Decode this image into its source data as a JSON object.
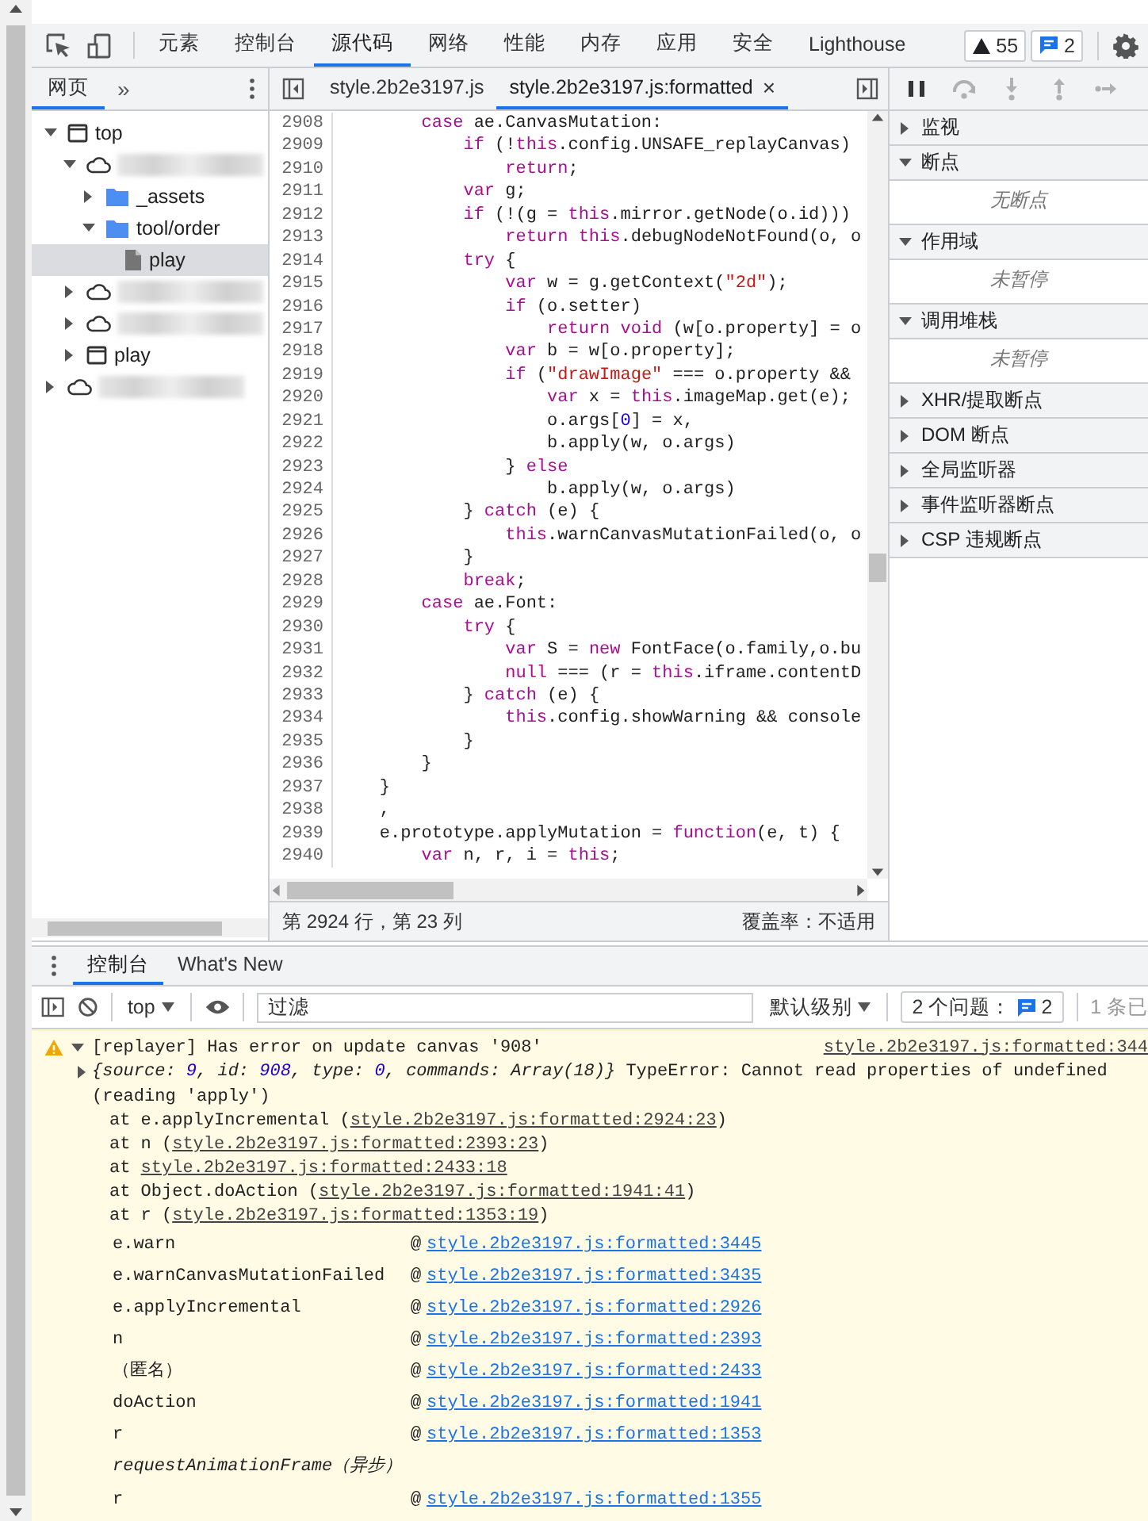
{
  "main_toolbar": {
    "tabs": [
      {
        "label": "元素",
        "selected": false
      },
      {
        "label": "控制台",
        "selected": false
      },
      {
        "label": "源代码",
        "selected": true
      },
      {
        "label": "网络",
        "selected": false
      },
      {
        "label": "性能",
        "selected": false
      },
      {
        "label": "内存",
        "selected": false
      },
      {
        "label": "应用",
        "selected": false
      },
      {
        "label": "安全",
        "selected": false
      },
      {
        "label": "Lighthouse",
        "selected": false
      }
    ],
    "badges": [
      {
        "kind": "warnings",
        "count": "55"
      },
      {
        "kind": "messages",
        "count": "2"
      }
    ]
  },
  "navigator": {
    "tabs": [
      {
        "label": "网页",
        "selected": true
      }
    ],
    "more": "»",
    "tree": [
      {
        "kind": "frame",
        "label": "top",
        "expanded": true,
        "selected": false,
        "children": [
          {
            "kind": "cloud",
            "redacted": true,
            "expanded": true,
            "selected": false,
            "children": [
              {
                "kind": "folder",
                "label": "_assets",
                "expanded": false,
                "selected": false
              },
              {
                "kind": "folder",
                "label": "tool/order",
                "expanded": true,
                "selected": false,
                "children": [
                  {
                    "kind": "file",
                    "label": "play",
                    "selected": true
                  }
                ]
              }
            ]
          },
          {
            "kind": "cloud",
            "redacted": true,
            "expanded": false,
            "selected": false
          },
          {
            "kind": "cloud",
            "redacted": true,
            "expanded": false,
            "selected": false
          },
          {
            "kind": "frame",
            "label": "play",
            "expanded": false,
            "selected": false
          }
        ]
      },
      {
        "kind": "cloud",
        "redacted": true,
        "expanded": false,
        "selected": false
      }
    ]
  },
  "editor": {
    "tabs": [
      {
        "label": "style.2b2e3197.js",
        "selected": false
      },
      {
        "label": "style.2b2e3197.js:formatted",
        "selected": true,
        "close": "×"
      }
    ],
    "lines": [
      {
        "number": "2908",
        "code": [
          {
            "kind": "keyword",
            "text": "        case"
          },
          {
            "kind": "plain",
            "text": " ae.CanvasMutation:"
          }
        ]
      },
      {
        "number": "2909",
        "code": [
          {
            "kind": "keyword",
            "text": "            if"
          },
          {
            "kind": "plain",
            "text": " (!"
          },
          {
            "kind": "keyword",
            "text": "this"
          },
          {
            "kind": "plain",
            "text": ".config.UNSAFE_replayCanvas)"
          }
        ]
      },
      {
        "number": "2910",
        "code": [
          {
            "kind": "keyword",
            "text": "                return"
          },
          {
            "kind": "plain",
            "text": ";"
          }
        ]
      },
      {
        "number": "2911",
        "code": [
          {
            "kind": "keyword",
            "text": "            var"
          },
          {
            "kind": "plain",
            "text": " g;"
          }
        ]
      },
      {
        "number": "2912",
        "code": [
          {
            "kind": "keyword",
            "text": "            if"
          },
          {
            "kind": "plain",
            "text": " (!(g = "
          },
          {
            "kind": "keyword",
            "text": "this"
          },
          {
            "kind": "plain",
            "text": ".mirror.getNode(o.id)))"
          }
        ]
      },
      {
        "number": "2913",
        "code": [
          {
            "kind": "keyword",
            "text": "                return"
          },
          {
            "kind": "keyword",
            "text": " this"
          },
          {
            "kind": "plain",
            "text": ".debugNodeNotFound(o, o"
          }
        ]
      },
      {
        "number": "2914",
        "code": [
          {
            "kind": "keyword",
            "text": "            try"
          },
          {
            "kind": "plain",
            "text": " {"
          }
        ]
      },
      {
        "number": "2915",
        "code": [
          {
            "kind": "keyword",
            "text": "                var"
          },
          {
            "kind": "plain",
            "text": " w = g.getContext("
          },
          {
            "kind": "string",
            "text": "\"2d\""
          },
          {
            "kind": "plain",
            "text": ");"
          }
        ]
      },
      {
        "number": "2916",
        "code": [
          {
            "kind": "keyword",
            "text": "                if"
          },
          {
            "kind": "plain",
            "text": " (o.setter)"
          }
        ]
      },
      {
        "number": "2917",
        "code": [
          {
            "kind": "keyword",
            "text": "                    return"
          },
          {
            "kind": "keyword",
            "text": " void"
          },
          {
            "kind": "plain",
            "text": " (w[o.property] = o"
          }
        ]
      },
      {
        "number": "2918",
        "code": [
          {
            "kind": "keyword",
            "text": "                var"
          },
          {
            "kind": "plain",
            "text": " b = w[o.property];"
          }
        ]
      },
      {
        "number": "2919",
        "code": [
          {
            "kind": "keyword",
            "text": "                if"
          },
          {
            "kind": "plain",
            "text": " ("
          },
          {
            "kind": "string",
            "text": "\"drawImage\""
          },
          {
            "kind": "plain",
            "text": " === o.property &&"
          }
        ]
      },
      {
        "number": "2920",
        "code": [
          {
            "kind": "keyword",
            "text": "                    var"
          },
          {
            "kind": "plain",
            "text": " x = "
          },
          {
            "kind": "keyword",
            "text": "this"
          },
          {
            "kind": "plain",
            "text": ".imageMap.get(e);"
          }
        ]
      },
      {
        "number": "2921",
        "code": [
          {
            "kind": "plain",
            "text": "                    o.args["
          },
          {
            "kind": "number",
            "text": "0"
          },
          {
            "kind": "plain",
            "text": "] = x,"
          }
        ]
      },
      {
        "number": "2922",
        "code": [
          {
            "kind": "plain",
            "text": "                    b.apply(w, o.args)"
          }
        ]
      },
      {
        "number": "2923",
        "code": [
          {
            "kind": "plain",
            "text": "                } "
          },
          {
            "kind": "keyword",
            "text": "else"
          }
        ]
      },
      {
        "number": "2924",
        "code": [
          {
            "kind": "plain",
            "text": "                    b.apply(w, o.args)"
          }
        ]
      },
      {
        "number": "2925",
        "code": [
          {
            "kind": "plain",
            "text": "            } "
          },
          {
            "kind": "keyword",
            "text": "catch"
          },
          {
            "kind": "plain",
            "text": " (e) {"
          }
        ]
      },
      {
        "number": "2926",
        "code": [
          {
            "kind": "keyword",
            "text": "                this"
          },
          {
            "kind": "plain",
            "text": ".warnCanvasMutationFailed(o, o"
          }
        ]
      },
      {
        "number": "2927",
        "code": [
          {
            "kind": "plain",
            "text": "            }"
          }
        ]
      },
      {
        "number": "2928",
        "code": [
          {
            "kind": "keyword",
            "text": "            break"
          },
          {
            "kind": "plain",
            "text": ";"
          }
        ]
      },
      {
        "number": "2929",
        "code": [
          {
            "kind": "keyword",
            "text": "        case"
          },
          {
            "kind": "plain",
            "text": " ae.Font:"
          }
        ]
      },
      {
        "number": "2930",
        "code": [
          {
            "kind": "keyword",
            "text": "            try"
          },
          {
            "kind": "plain",
            "text": " {"
          }
        ]
      },
      {
        "number": "2931",
        "code": [
          {
            "kind": "keyword",
            "text": "                var"
          },
          {
            "kind": "plain",
            "text": " S = "
          },
          {
            "kind": "keyword",
            "text": "new"
          },
          {
            "kind": "plain",
            "text": " FontFace(o.family,o.bu"
          }
        ]
      },
      {
        "number": "2932",
        "code": [
          {
            "kind": "keyword",
            "text": "                null"
          },
          {
            "kind": "plain",
            "text": " === (r = "
          },
          {
            "kind": "keyword",
            "text": "this"
          },
          {
            "kind": "plain",
            "text": ".iframe.contentD"
          }
        ]
      },
      {
        "number": "2933",
        "code": [
          {
            "kind": "plain",
            "text": "            } "
          },
          {
            "kind": "keyword",
            "text": "catch"
          },
          {
            "kind": "plain",
            "text": " (e) {"
          }
        ]
      },
      {
        "number": "2934",
        "code": [
          {
            "kind": "keyword",
            "text": "                this"
          },
          {
            "kind": "plain",
            "text": ".config.showWarning && console"
          }
        ]
      },
      {
        "number": "2935",
        "code": [
          {
            "kind": "plain",
            "text": "            }"
          }
        ]
      },
      {
        "number": "2936",
        "code": [
          {
            "kind": "plain",
            "text": "        }"
          }
        ]
      },
      {
        "number": "2937",
        "code": [
          {
            "kind": "plain",
            "text": "    }"
          }
        ]
      },
      {
        "number": "2938",
        "code": [
          {
            "kind": "plain",
            "text": "    ,"
          }
        ]
      },
      {
        "number": "2939",
        "code": [
          {
            "kind": "plain",
            "text": "    e.prototype.applyMutation = "
          },
          {
            "kind": "keyword",
            "text": "function"
          },
          {
            "kind": "plain",
            "text": "(e, t) {"
          }
        ]
      },
      {
        "number": "2940",
        "code": [
          {
            "kind": "keyword",
            "text": "        var"
          },
          {
            "kind": "plain",
            "text": " n, r, i = "
          },
          {
            "kind": "keyword",
            "text": "this"
          },
          {
            "kind": "plain",
            "text": ";"
          }
        ]
      }
    ],
    "status": {
      "position": "第 2924 行，第 23 列",
      "coverage": "覆盖率：不适用"
    }
  },
  "debugger": {
    "buttons": [
      {
        "kind": "pause",
        "disabled": false
      },
      {
        "kind": "step-over",
        "disabled": true
      },
      {
        "kind": "step-into",
        "disabled": true
      },
      {
        "kind": "step-out",
        "disabled": true
      },
      {
        "kind": "step",
        "disabled": true
      }
    ],
    "sections": [
      {
        "title": "监视",
        "expanded": false
      },
      {
        "title": "断点",
        "expanded": true,
        "empty_text": "无断点"
      },
      {
        "title": "作用域",
        "expanded": true,
        "empty_text": "未暂停"
      },
      {
        "title": "调用堆栈",
        "expanded": true,
        "empty_text": "未暂停"
      },
      {
        "title": "XHR/提取断点",
        "expanded": false
      },
      {
        "title": "DOM 断点",
        "expanded": false
      },
      {
        "title": "全局监听器",
        "expanded": false
      },
      {
        "title": "事件监听器断点",
        "expanded": false
      },
      {
        "title": "CSP 违规断点",
        "expanded": false
      }
    ]
  },
  "drawer": {
    "tabs": [
      {
        "label": "控制台",
        "selected": true
      },
      {
        "label": "What's New",
        "selected": false
      }
    ],
    "toolbar": {
      "context": "top",
      "filter_placeholder": "过滤",
      "level": "默认级别",
      "issues_label": "2 个问题：",
      "issues_count": "2",
      "hidden_count": "1 条已"
    },
    "messages": [
      {
        "kind": "warning",
        "expanded": true,
        "text": "[replayer] Has error on update canvas '908'",
        "source": "style.2b2e3197.js:formatted:344",
        "preview_expanded": false,
        "preview": [
          {
            "kind": "plain",
            "text": "{source: "
          },
          {
            "kind": "number",
            "text": "9"
          },
          {
            "kind": "plain",
            "text": ", id: "
          },
          {
            "kind": "number",
            "text": "908"
          },
          {
            "kind": "plain",
            "text": ", type: "
          },
          {
            "kind": "number",
            "text": "0"
          },
          {
            "kind": "plain",
            "text": ", commands: Array(18)}"
          }
        ],
        "error": "TypeError: Cannot read properties of undefined (reading 'apply')",
        "stack": [
          {
            "prefix": "at e.applyIncremental (",
            "link": "style.2b2e3197.js:formatted:2924:23",
            "suffix": ")"
          },
          {
            "prefix": "at n (",
            "link": "style.2b2e3197.js:formatted:2393:23",
            "suffix": ")"
          },
          {
            "prefix": "at",
            "link": "style.2b2e3197.js:formatted:2433:18"
          },
          {
            "prefix": "at Object.doAction (",
            "link": "style.2b2e3197.js:formatted:1941:41",
            "suffix": ")"
          },
          {
            "prefix": "at r (",
            "link": "style.2b2e3197.js:formatted:1353:19",
            "suffix": ")"
          }
        ],
        "frames": [
          {
            "kind": "call",
            "function": "e.warn",
            "at": "@",
            "link": "style.2b2e3197.js:formatted:3445"
          },
          {
            "kind": "call",
            "function": "e.warnCanvasMutationFailed",
            "at": "@",
            "link": "style.2b2e3197.js:formatted:3435"
          },
          {
            "kind": "call",
            "function": "e.applyIncremental",
            "at": "@",
            "link": "style.2b2e3197.js:formatted:2926"
          },
          {
            "kind": "call",
            "function": "n",
            "at": "@",
            "link": "style.2b2e3197.js:formatted:2393"
          },
          {
            "kind": "call",
            "function": "（匿名）",
            "at": "@",
            "link": "style.2b2e3197.js:formatted:2433"
          },
          {
            "kind": "call",
            "function": "doAction",
            "at": "@",
            "link": "style.2b2e3197.js:formatted:1941"
          },
          {
            "kind": "call",
            "function": "r",
            "at": "@",
            "link": "style.2b2e3197.js:formatted:1353"
          },
          {
            "kind": "async",
            "label": "requestAnimationFrame（异步）"
          },
          {
            "kind": "call",
            "function": "r",
            "at": "@",
            "link": "style.2b2e3197.js:formatted:1355"
          }
        ]
      }
    ]
  }
}
